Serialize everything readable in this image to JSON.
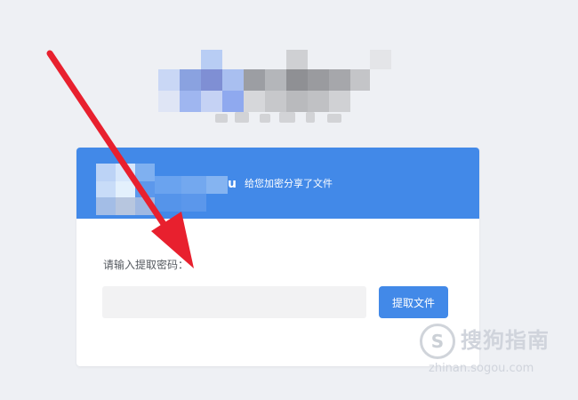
{
  "share": {
    "username_tail": "u",
    "message": "给您加密分享了文件"
  },
  "form": {
    "prompt_label": "请输入提取密码：",
    "code_value": "",
    "code_placeholder": "",
    "submit_label": "提取文件"
  },
  "watermark": {
    "title": "搜狗指南",
    "domain": "zhinan.sogou.com"
  },
  "colors": {
    "accent": "#4289e8",
    "arrow": "#e8202e",
    "page_background": "#eef0f4"
  }
}
